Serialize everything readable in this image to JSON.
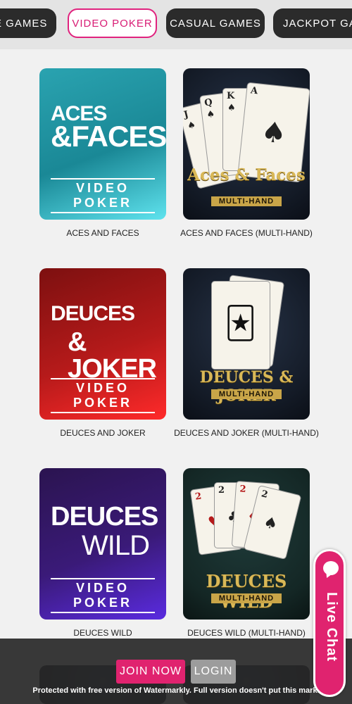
{
  "tabs": [
    {
      "label": "LE GAMES",
      "active": false
    },
    {
      "label": "VIDEO POKER",
      "active": true
    },
    {
      "label": "CASUAL GAMES",
      "active": false
    },
    {
      "label": "JACKPOT GAM",
      "active": false
    }
  ],
  "games": [
    {
      "name": "ACES AND FACES",
      "art": {
        "line1": "ACES",
        "line2": "&FACES",
        "sub": "VIDEO POKER"
      }
    },
    {
      "name": "ACES AND FACES (MULTI-HAND)",
      "art": {
        "title": "Aces & Faces",
        "sub": "MULTI-HAND",
        "cards": [
          "J",
          "Q",
          "K",
          "A"
        ]
      }
    },
    {
      "name": "DEUCES AND JOKER",
      "art": {
        "line1": "DEUCES",
        "line2": "& JOKER",
        "sub": "VIDEO POKER"
      }
    },
    {
      "name": "DEUCES AND JOKER (MULTI-HAND)",
      "art": {
        "title": "DEUCES & JOKER",
        "sub": "MULTI-HAND"
      }
    },
    {
      "name": "DEUCES WILD",
      "art": {
        "line1": "DEUCES",
        "line2": "WILD",
        "sub": "VIDEO POKER"
      }
    },
    {
      "name": "DEUCES WILD (MULTI-HAND)",
      "art": {
        "title": "DEUCES WILD",
        "sub": "MULTI-HAND",
        "cards": [
          "2",
          "2",
          "2",
          "2"
        ]
      }
    }
  ],
  "actions": {
    "join": "JOIN NOW",
    "login": "LOGIN"
  },
  "watermark": "Protected with free version of Watermarkly. Full version doesn't put this mark.",
  "live_chat": "Live Chat",
  "colors": {
    "accent": "#e0236f",
    "tab_dark": "#2b2b2b",
    "bar": "#282828"
  }
}
